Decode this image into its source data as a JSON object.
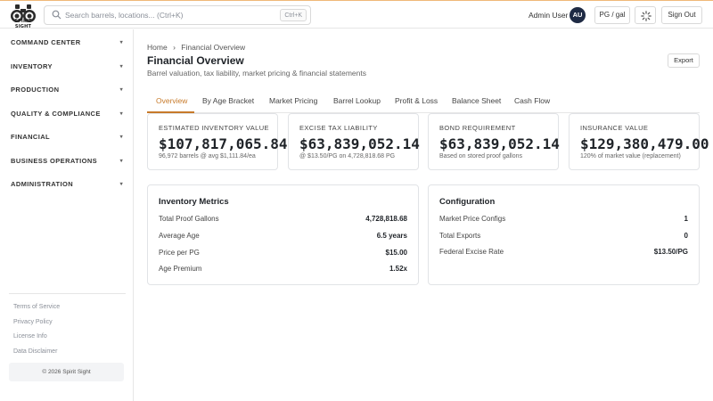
{
  "brand": {
    "logo_text": "SPIRIT SIGHT"
  },
  "topbar": {
    "search_placeholder": "Search barrels, locations... (Ctrl+K)",
    "search_shortcut": "Ctrl+K",
    "user_name": "Admin User",
    "avatar_initials": "AU",
    "unit_label": "PG / gal",
    "signout_label": "Sign Out"
  },
  "sidebar": {
    "items": [
      {
        "label": "COMMAND CENTER"
      },
      {
        "label": "INVENTORY"
      },
      {
        "label": "PRODUCTION"
      },
      {
        "label": "QUALITY & COMPLIANCE"
      },
      {
        "label": "FINANCIAL"
      },
      {
        "label": "BUSINESS OPERATIONS"
      },
      {
        "label": "ADMINISTRATION"
      }
    ],
    "footer_links": [
      {
        "label": "Terms of Service"
      },
      {
        "label": "Privacy Policy"
      },
      {
        "label": "License Info"
      },
      {
        "label": "Data Disclaimer"
      }
    ],
    "copyright": "© 2026 Spirit Sight"
  },
  "header": {
    "breadcrumb": [
      "Home",
      "›",
      "Financial Overview"
    ],
    "title": "Financial Overview",
    "subtitle": "Barrel valuation, tax liability, market pricing & financial statements",
    "export_label": "Export"
  },
  "tabs": [
    {
      "label": "Overview",
      "active": true
    },
    {
      "label": "By Age Bracket"
    },
    {
      "label": "Market Pricing"
    },
    {
      "label": "Barrel Lookup"
    },
    {
      "label": "Profit & Loss"
    },
    {
      "label": "Balance Sheet"
    },
    {
      "label": "Cash Flow"
    }
  ],
  "kpis": [
    {
      "label": "ESTIMATED INVENTORY VALUE",
      "value": "$107,817,065.84",
      "note": "96,972 barrels @ avg $1,111.84/ea"
    },
    {
      "label": "EXCISE TAX LIABILITY",
      "value": "$63,839,052.14",
      "note": "@ $13.50/PG on 4,728,818.68 PG"
    },
    {
      "label": "BOND REQUIREMENT",
      "value": "$63,839,052.14",
      "note": "Based on stored proof gallons"
    },
    {
      "label": "INSURANCE VALUE",
      "value": "$129,380,479.00",
      "note": "120% of market value (replacement)"
    }
  ],
  "inventory_metrics": {
    "title": "Inventory Metrics",
    "rows": [
      {
        "key": "Total Proof Gallons",
        "value": "4,728,818.68"
      },
      {
        "key": "Average Age",
        "value": "6.5 years"
      },
      {
        "key": "Price per PG",
        "value": "$15.00"
      },
      {
        "key": "Age Premium",
        "value": "1.52x"
      }
    ]
  },
  "configuration": {
    "title": "Configuration",
    "rows": [
      {
        "key": "Market Price Configs",
        "value": "1"
      },
      {
        "key": "Total Exports",
        "value": "0"
      },
      {
        "key": "Federal Excise Rate",
        "value": "$13.50/PG"
      }
    ]
  },
  "colors": {
    "accent": "#c77a2a",
    "top_border": "#f0b879",
    "avatar_bg": "#1e2a44"
  }
}
